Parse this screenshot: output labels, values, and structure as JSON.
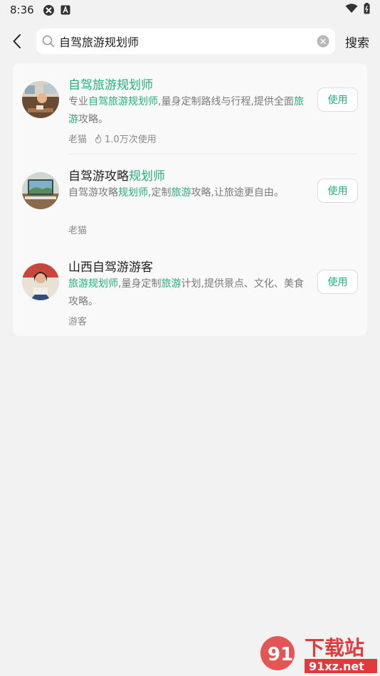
{
  "status_bar": {
    "time": "8:36"
  },
  "search": {
    "back_icon": "chevron-left-icon",
    "query": "自驾旅游规划师",
    "button_label": "搜索"
  },
  "results": [
    {
      "title_parts": [
        {
          "text": "自驾旅游规划师",
          "hl": true
        }
      ],
      "desc_parts": [
        {
          "text": "专业",
          "hl": false
        },
        {
          "text": "自驾旅游规划师",
          "hl": true
        },
        {
          "text": ",量身定制路线与行程,提供全面",
          "hl": false
        },
        {
          "text": "旅游",
          "hl": true
        },
        {
          "text": "攻略。",
          "hl": false
        }
      ],
      "author": "老猫",
      "usage": "1.0万次使用",
      "button": "使用"
    },
    {
      "title_parts": [
        {
          "text": "自驾游攻略",
          "hl": false
        },
        {
          "text": "规划师",
          "hl": true
        }
      ],
      "desc_parts": [
        {
          "text": "自驾游攻略",
          "hl": false
        },
        {
          "text": "规划师",
          "hl": true
        },
        {
          "text": ",定制",
          "hl": false
        },
        {
          "text": "旅游",
          "hl": true
        },
        {
          "text": "攻略,让旅途更自由。",
          "hl": false
        }
      ],
      "author": "老猫",
      "usage": "",
      "button": "使用"
    },
    {
      "title_parts": [
        {
          "text": "山西自驾游游客",
          "hl": false
        }
      ],
      "desc_parts": [
        {
          "text": "旅游规划师",
          "hl": true
        },
        {
          "text": ",量身定制",
          "hl": false
        },
        {
          "text": "旅游",
          "hl": true
        },
        {
          "text": "计划,提供景点、文化、美食攻略。",
          "hl": false
        }
      ],
      "author": "游客",
      "usage": "",
      "button": "使用"
    }
  ],
  "watermark": {
    "brand": "下载站",
    "domain": "91xz.net"
  },
  "colors": {
    "accent": "#22b07d",
    "background": "#f2f2f3",
    "card": "#f9f9f9"
  }
}
